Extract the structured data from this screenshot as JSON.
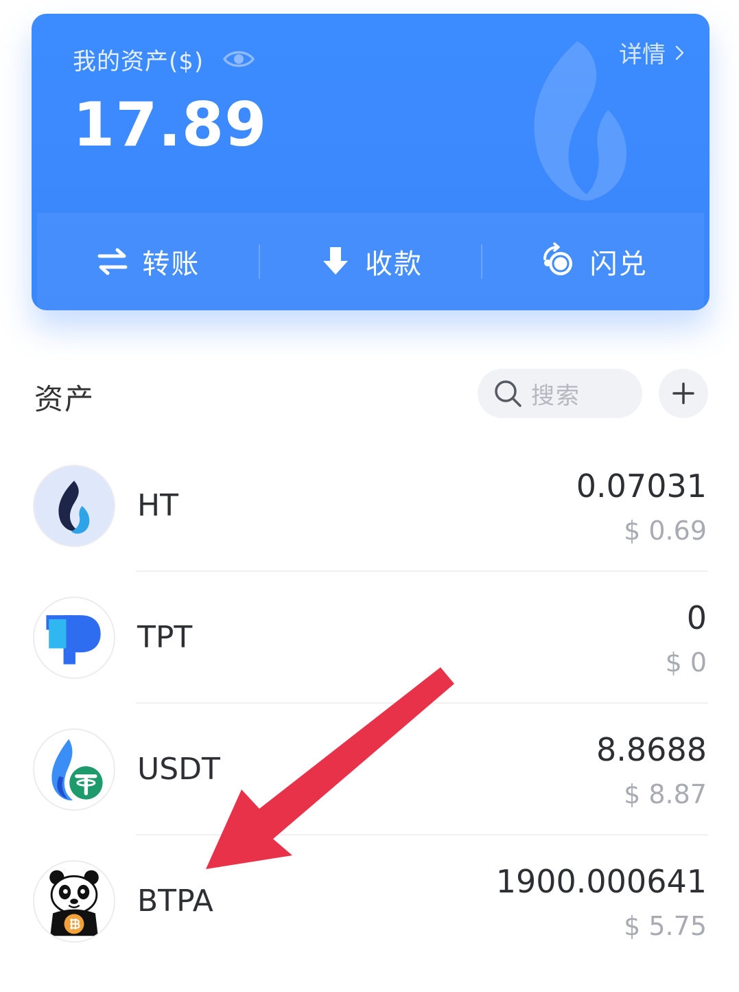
{
  "card": {
    "label": "我的资产($)",
    "balance": "17.89",
    "detail_label": "详情",
    "actions": [
      {
        "label": "转账",
        "icon": "transfer-arrows-icon"
      },
      {
        "label": "收款",
        "icon": "receive-down-arrow-icon"
      },
      {
        "label": "闪兑",
        "icon": "swap-coins-icon"
      }
    ]
  },
  "assets": {
    "title": "资产",
    "search_placeholder": "搜索",
    "add_icon": "plus-icon"
  },
  "tokens": [
    {
      "symbol": "HT",
      "amount": "0.07031",
      "value": "$ 0.69",
      "icon": "ht-flame-icon"
    },
    {
      "symbol": "TPT",
      "amount": "0",
      "value": "$ 0",
      "icon": "tpt-logo-icon"
    },
    {
      "symbol": "USDT",
      "amount": "8.8688",
      "value": "$ 8.87",
      "icon": "usdt-tether-icon"
    },
    {
      "symbol": "BTPA",
      "amount": "1900.000641",
      "value": "$ 5.75",
      "icon": "panda-bitcoin-icon"
    }
  ],
  "annotation": {
    "color": "#e8324a",
    "points_to": "BTPA"
  },
  "colors": {
    "card_blue": "#3d8cff",
    "text_primary": "#2d2f33",
    "text_secondary": "#a9abb2"
  }
}
